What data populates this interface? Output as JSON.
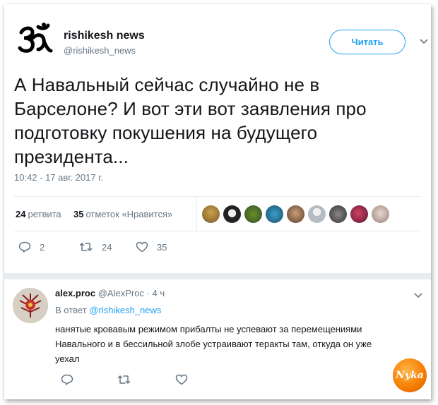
{
  "tweet": {
    "author_name": "rishikesh news",
    "author_handle": "@rishikesh_news",
    "follow_label": "Читать",
    "text": "А Навальный сейчас случайно не в Барселоне? И вот эти вот заявления про подготовку покушения на будущего президента...",
    "timestamp": "10:42 - 17 авг. 2017 г.",
    "retweets_count": "24",
    "retweets_label": "ретвита",
    "likes_count": "35",
    "likes_label": "отметок «Нравится»",
    "replies_action_count": "2",
    "retweets_action_count": "24",
    "likes_action_count": "35"
  },
  "reply": {
    "author_name": "alex.proc",
    "author_handle": "@AlexProc",
    "time": "· 4 ч",
    "in_reply_prefix": "В ответ",
    "in_reply_handle": "@rishikesh_news",
    "text": "нанятые кровавым режимом прибалты не успевают за перемещениями Навального и в бессильной злобе устраивают теракты там, откуда он уже уехал"
  },
  "colors": {
    "accent": "#1da1f2",
    "muted": "#657786",
    "text": "#14171a"
  },
  "icons": [
    "om-logo-icon",
    "chevron-down-icon",
    "reply-icon",
    "retweet-icon",
    "heart-icon"
  ]
}
